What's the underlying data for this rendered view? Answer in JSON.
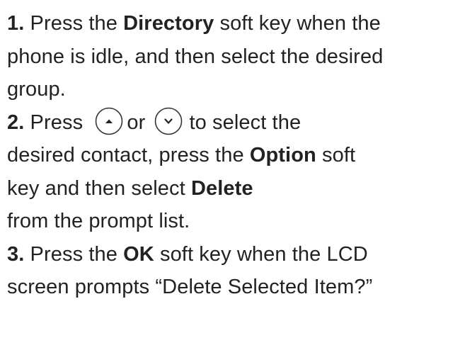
{
  "steps": [
    {
      "number": "1.",
      "line1": {
        "pre": " Press the ",
        "bold": "Directory",
        "post": " soft key when the"
      },
      "line2": "phone is idle, and then select the desired",
      "line3": "group."
    },
    {
      "number": "2.",
      "line1": {
        "pre": " Press ",
        "mid": "or ",
        "post": "to select the"
      },
      "line2": {
        "pre": "desired contact, press the ",
        "bold": "Option",
        "post": " soft"
      },
      "line3": {
        "pre": "key and then select ",
        "bold": "Delete"
      },
      "line4": "from the prompt list.",
      "icons": [
        "up-arrow-key-icon",
        "down-arrow-key-icon"
      ]
    },
    {
      "number": "3.",
      "line1": {
        "pre": " Press the ",
        "bold": "OK",
        "post": " soft key when the LCD"
      },
      "line2": "screen prompts “Delete Selected Item?”"
    }
  ]
}
